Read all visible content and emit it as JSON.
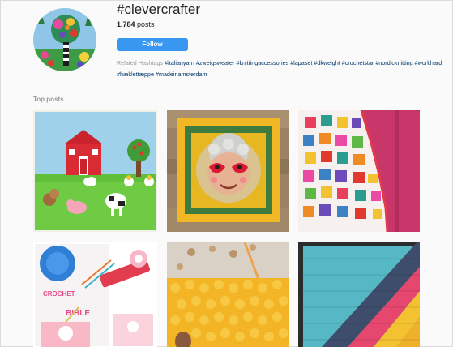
{
  "hashtag": "#clevercrafter",
  "posts": {
    "count": "1,784",
    "label": "posts"
  },
  "follow_label": "Follow",
  "related": {
    "label": "Related Hashtags",
    "row1": [
      "#italianyarn",
      "#zweigsweater",
      "#knittingaccessories",
      "#lapaset",
      "#dkweight",
      "#crochetstar",
      "#nordicknitting",
      "#workhard"
    ],
    "row2": [
      "#hæklettæppe",
      "#madeinamsterdam"
    ]
  },
  "top_posts_label": "Top posts",
  "tiles": [
    {
      "name": "post-farm-blanket"
    },
    {
      "name": "post-granny-square-face"
    },
    {
      "name": "post-granny-blanket"
    },
    {
      "name": "post-crochet-bible"
    },
    {
      "name": "post-yellow-stitches"
    },
    {
      "name": "post-striped-blanket"
    }
  ],
  "bible_text": {
    "line1": "CROCHET",
    "line2": "BIBLE"
  }
}
